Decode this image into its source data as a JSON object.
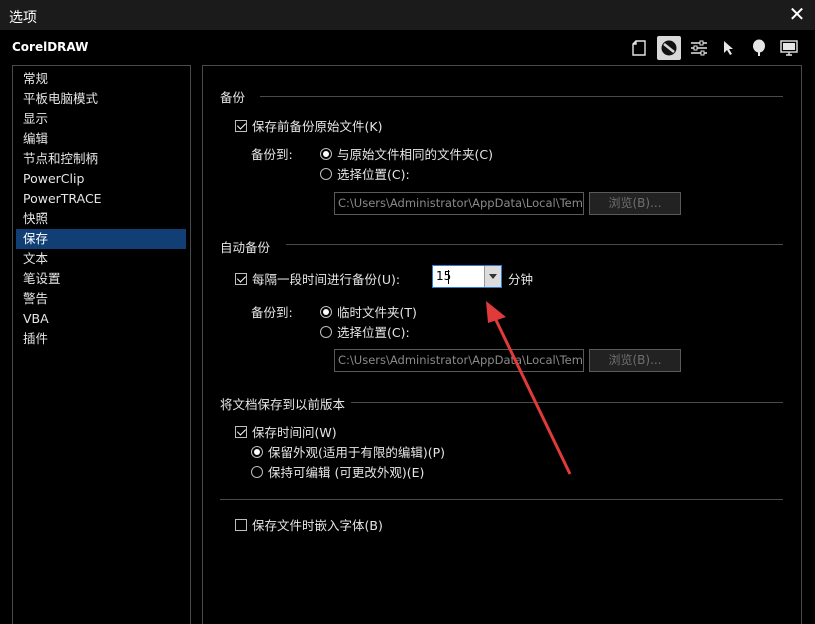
{
  "window": {
    "title": "选项",
    "close_glyph": "✕"
  },
  "app": {
    "name": "CorelDRAW"
  },
  "toolbar": {
    "icons": [
      "page-icon",
      "no-entry-icon",
      "sliders-icon",
      "cursor-icon",
      "balloon-icon",
      "monitor-icon"
    ],
    "active_icon": "no-entry-icon"
  },
  "sidebar": {
    "items": [
      "常规",
      "平板电脑模式",
      "显示",
      "编辑",
      "节点和控制柄",
      "PowerClip",
      "PowerTRACE",
      "快照",
      "保存",
      "文本",
      "笔设置",
      "警告",
      "VBA",
      "插件"
    ],
    "selected": "保存"
  },
  "backup": {
    "title": "备份",
    "make_backup_label": "保存前备份原始文件(K)",
    "make_backup_checked": true,
    "backup_to_label": "备份到:",
    "same_folder_label": "与原始文件相同的文件夹(C)",
    "same_folder_selected": true,
    "specific_folder_label": "选择位置(C):",
    "path_value": "C:\\Users\\Administrator\\AppData\\Local\\Temp\\",
    "browse_label": "浏览(B)..."
  },
  "autobackup": {
    "title": "自动备份",
    "every_label": "每隔一段时间进行备份(U):",
    "every_checked": true,
    "interval_value": "15",
    "unit_label": "分钟",
    "backup_to_label": "备份到:",
    "temp_folder_label": "临时文件夹(T)",
    "temp_folder_selected": true,
    "specific_folder_label": "选择位置(C):",
    "path_value": "C:\\Users\\Administrator\\AppData\\Local\\Temp\\",
    "browse_label": "浏览(B)..."
  },
  "previous_version": {
    "title": "将文档保存到以前版本",
    "save_time_label": "保存时间问(W)",
    "save_time_checked": true,
    "keep_appearance_label": "保留外观(适用于有限的编辑)(P)",
    "keep_appearance_selected": true,
    "keep_editable_label": "保持可编辑 (可更改外观)(E)"
  },
  "embed_fonts": {
    "label": "保存文件时嵌入字体(B)",
    "checked": false
  },
  "colors": {
    "selection": "#113f75",
    "annotation_arrow": "#e03a3a",
    "combo_border": "#2f7ad6"
  }
}
